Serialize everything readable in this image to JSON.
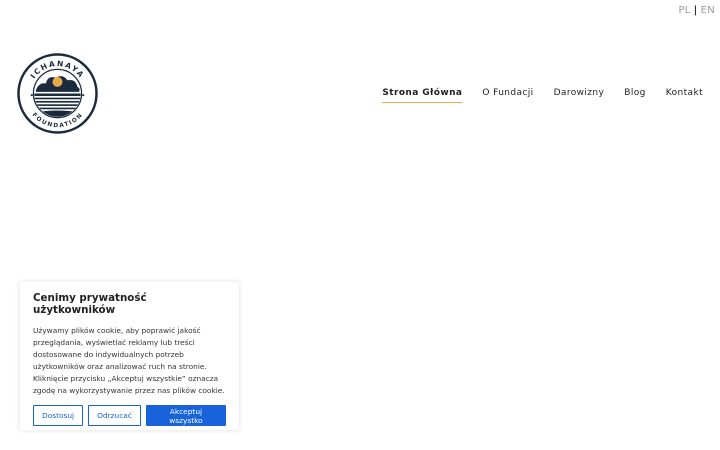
{
  "language": {
    "pl": "PL",
    "separator": "|",
    "en": "EN"
  },
  "logo": {
    "top_text": "ICHANAYA",
    "bottom_text": "FOUNDATION",
    "colors": {
      "ring": "#1b2a3d",
      "sun": "#e8a948"
    }
  },
  "nav": [
    {
      "label": "Strona Główna",
      "active": true
    },
    {
      "label": "O Fundacji",
      "active": false
    },
    {
      "label": "Darowizny",
      "active": false
    },
    {
      "label": "Blog",
      "active": false
    },
    {
      "label": "Kontakt",
      "active": false
    }
  ],
  "cookie": {
    "title": "Cenimy prywatność użytkowników",
    "body": "Używamy plików cookie, aby poprawić jakość przeglądania, wyświetlać reklamy lub treści dostosowane do indywidualnych potrzeb użytkowników oraz analizować ruch na stronie. Kliknięcie przycisku „Akceptuj wszystkie” oznacza zgodę na wykorzystywanie przez nas plików cookie.",
    "customize_label": "Dostosuj",
    "reject_label": "Odrzucać",
    "accept_label": "Akceptuj wszystko"
  },
  "colors": {
    "accent": "#e8a948",
    "button_blue": "#1863dc"
  }
}
